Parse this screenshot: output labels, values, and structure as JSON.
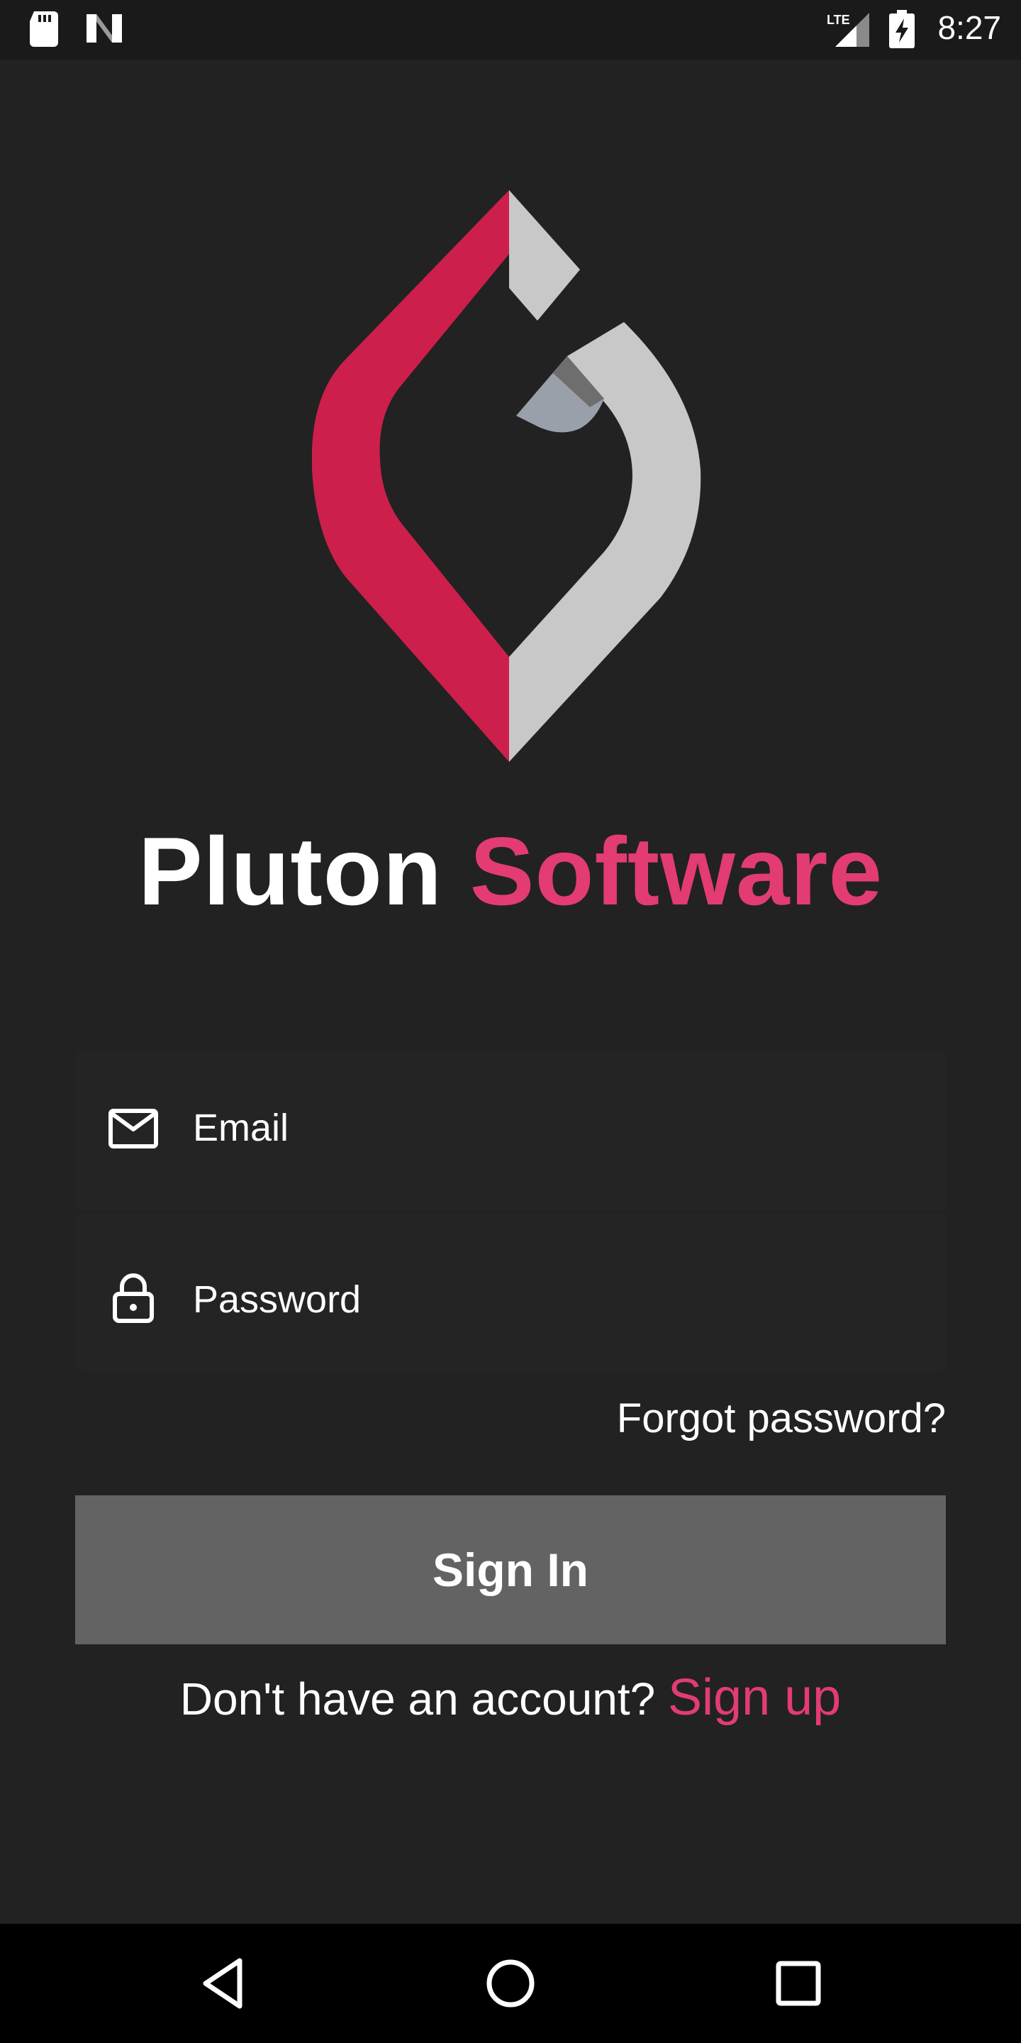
{
  "status_bar": {
    "time": "8:27",
    "icons": [
      "sd-card-icon",
      "n-notification-icon",
      "lte-signal-icon",
      "battery-charging-icon"
    ],
    "lte_label": "LTE"
  },
  "logo": {
    "name": "pluton-logo",
    "colors": {
      "red": "#cc1f4b",
      "gray": "#c8c8c8",
      "accent": "#9aa0aa"
    }
  },
  "title": {
    "part1": "Pluton",
    "part2": "Software",
    "accent_color": "#e23c72"
  },
  "form": {
    "email": {
      "placeholder": "Email",
      "value": "",
      "icon": "mail-icon"
    },
    "password": {
      "placeholder": "Password",
      "value": "",
      "icon": "lock-icon"
    },
    "forgot_label": "Forgot password?",
    "signin_label": "Sign In"
  },
  "signup": {
    "prompt": "Don't have an account? ",
    "link_label": "Sign up"
  },
  "nav_bar": {
    "buttons": [
      "back-icon",
      "home-icon",
      "recents-icon"
    ]
  }
}
